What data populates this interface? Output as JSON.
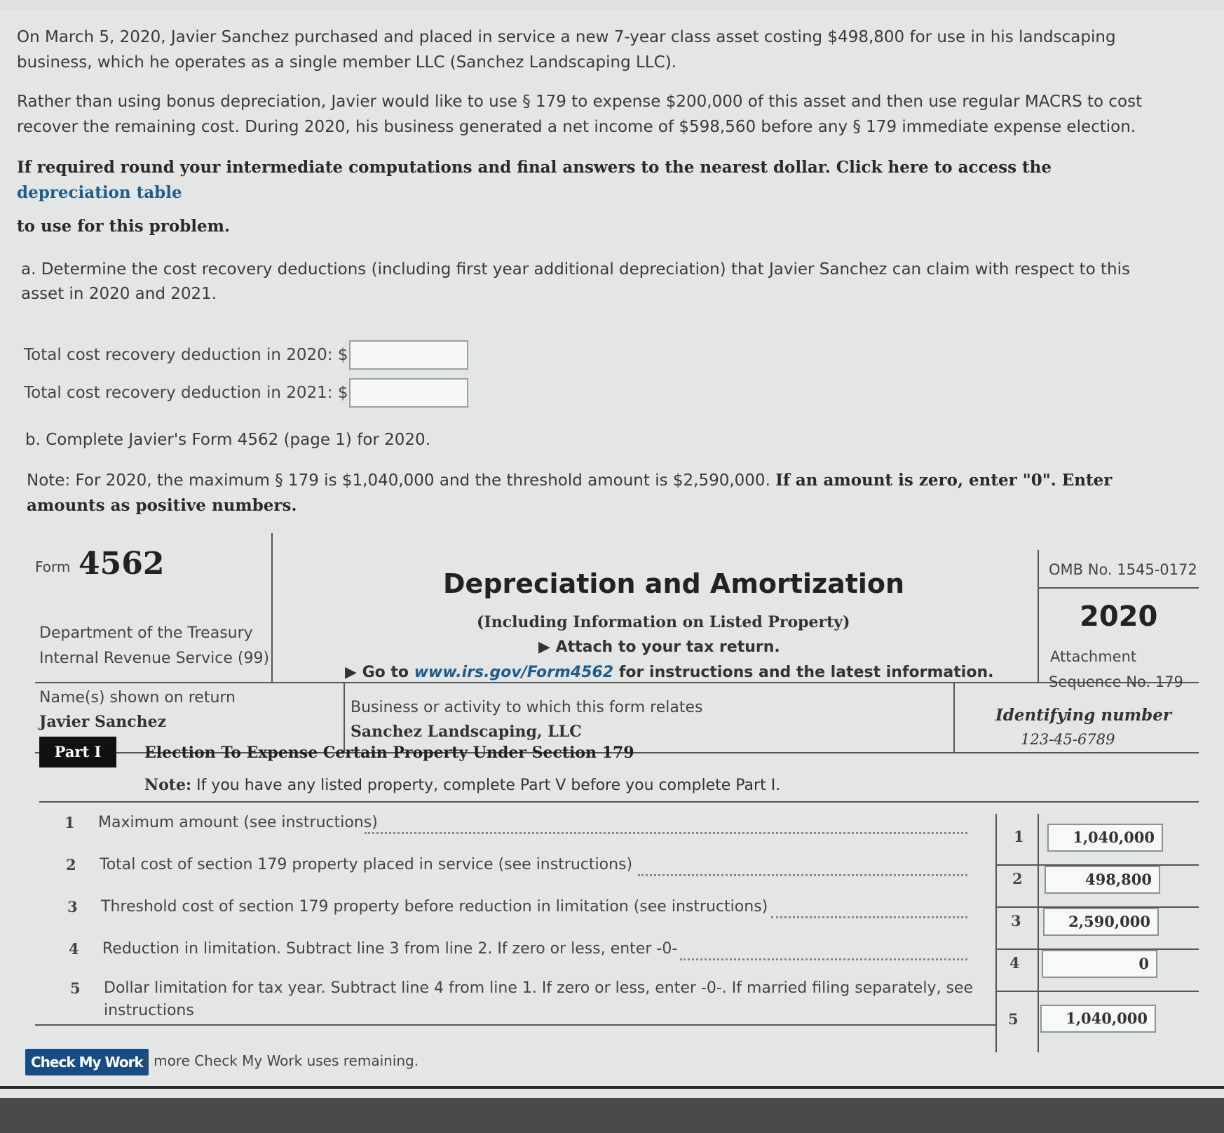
{
  "problem": {
    "para1": "On March 5, 2020, Javier Sanchez purchased and placed in service a new 7-year class asset costing $498,800 for use in his landscaping business, which he operates as a single member LLC (Sanchez Landscaping LLC).",
    "para1_line1": "On March 5, 2020, Javier Sanchez purchased and placed in service a new 7-year class asset costing $498,800 for use in his landscaping",
    "para1_line2": "business, which he operates as a single member LLC (Sanchez Landscaping LLC).",
    "para2_line1": "Rather than using bonus depreciation, Javier would like to use § 179 to expense $200,000 of this asset and then use regular MACRS to cost",
    "para2_line2": "recover the remaining cost. During 2020, his business generated a net income of $598,560 before any § 179 immediate expense election.",
    "instr_line1": "If required round your intermediate computations and final answers to the nearest dollar. Click here to access the",
    "instr_link": "depreciation table",
    "instr_line3": "to use for this problem."
  },
  "part_a": {
    "line1": "a. Determine the cost recovery deductions (including first year additional depreciation) that Javier Sanchez can claim with respect to this",
    "line2": "asset in 2020 and 2021.",
    "label_2020": "Total cost recovery deduction in 2020: $",
    "label_2021": "Total cost recovery deduction in 2021: $",
    "value_2020": "",
    "value_2021": ""
  },
  "part_b": {
    "line1": "b. Complete Javier's Form 4562 (page 1) for 2020.",
    "note_line1_plain": "Note: For 2020, the maximum § 179 is $1,040,000 and the threshold amount is $2,590,000.",
    "note_line1_bold": "If an amount is zero, enter \"0\". Enter",
    "note_line2_bold": "amounts as positive numbers."
  },
  "form": {
    "form_word": "Form",
    "form_number": "4562",
    "title": "Depreciation and Amortization",
    "subtitle": "(Including Information on Listed Property)",
    "attach": "▶ Attach to your tax return.",
    "goto_prefix": "▶ Go to",
    "goto_link": "www.irs.gov/Form4562",
    "goto_suffix": "for instructions and the latest information.",
    "dept1": "Department of the Treasury",
    "dept2": "Internal Revenue Service (99)",
    "omb": "OMB No. 1545-0172",
    "year": "2020",
    "attachment": "Attachment",
    "sequence": "Sequence No. 179",
    "name_label": "Name(s) shown on return",
    "name_value": "Javier Sanchez",
    "business_label": "Business or activity to which this form relates",
    "business_value": "Sanchez Landscaping, LLC",
    "id_label": "Identifying number",
    "id_value": "123-45-6789",
    "part_label": "Part I",
    "part_title": "Election To Expense Certain Property Under Section 179",
    "part_note_bold": "Note:",
    "part_note": "If you have any listed property, complete Part V before you complete Part I.",
    "lines": [
      {
        "num": "1",
        "desc": "Maximum amount (see instructions)",
        "box": "1",
        "value": "1,040,000"
      },
      {
        "num": "2",
        "desc": "Total cost of section 179 property placed in service (see instructions)",
        "box": "2",
        "value": "498,800"
      },
      {
        "num": "3",
        "desc": "Threshold cost of section 179 property before reduction in limitation (see instructions)",
        "box": "3",
        "value": "2,590,000"
      },
      {
        "num": "4",
        "desc": "Reduction in limitation. Subtract line 3 from line 2. If zero or less, enter -0-",
        "box": "4",
        "value": "0"
      },
      {
        "num": "5",
        "desc": "Dollar limitation for tax year. Subtract line 4 from line 1. If zero or less, enter -0-. If married filing separately, see",
        "desc2": "instructions",
        "box": "5",
        "value": "1,040,000"
      }
    ]
  },
  "footer": {
    "check_button": "Check My Work",
    "remaining": "2 more Check My Work uses remaining."
  },
  "colors": {
    "background": "#e4e6e5",
    "link": "#1f5d8c",
    "button": "#174d86"
  }
}
